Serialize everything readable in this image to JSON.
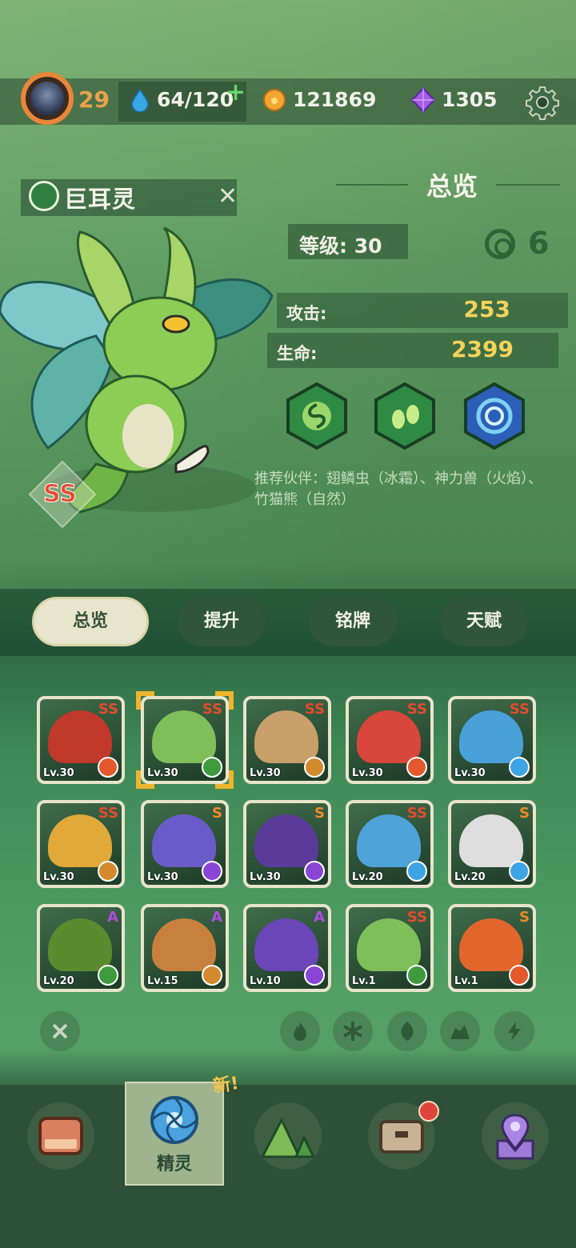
{
  "player": {
    "level": "29"
  },
  "resources": {
    "stamina": "64/120",
    "coins": "121869",
    "gems": "1305"
  },
  "monster": {
    "name": "巨耳灵",
    "grade": "SS"
  },
  "overview": {
    "title": "总览",
    "level_label": "等级: 30",
    "attack_label": "攻击:",
    "attack_value": "253",
    "hp_label": "生命:",
    "hp_value": "2399",
    "recommend_text": "推荐伙伴：翅鳞虫（冰霜）、神力兽（火焰）、竹猫熊（自然）"
  },
  "tabs": [
    {
      "label": "总览"
    },
    {
      "label": "提升"
    },
    {
      "label": "铭牌"
    },
    {
      "label": "天赋"
    }
  ],
  "cards": [
    {
      "level": "Lv.30",
      "grade": "SS",
      "element": "fire",
      "color": "#c0392b"
    },
    {
      "level": "Lv.30",
      "grade": "SS",
      "element": "nature",
      "color": "#7fbf5a"
    },
    {
      "level": "Lv.30",
      "grade": "SS",
      "element": "earth",
      "color": "#c9a06a"
    },
    {
      "level": "Lv.30",
      "grade": "SS",
      "element": "fire",
      "color": "#d9463b"
    },
    {
      "level": "Lv.30",
      "grade": "SS",
      "element": "ice",
      "color": "#4aa0d8"
    },
    {
      "level": "Lv.30",
      "grade": "SS",
      "element": "earth",
      "color": "#e0a93a"
    },
    {
      "level": "Lv.30",
      "grade": "S",
      "element": "thunder",
      "color": "#6a5bc9"
    },
    {
      "level": "Lv.30",
      "grade": "S",
      "element": "thunder",
      "color": "#5b3b9a"
    },
    {
      "level": "Lv.20",
      "grade": "SS",
      "element": "ice",
      "color": "#4fa3db"
    },
    {
      "level": "Lv.20",
      "grade": "S",
      "element": "ice",
      "color": "#dedede"
    },
    {
      "level": "Lv.20",
      "grade": "A",
      "element": "nature",
      "color": "#5c8a2f"
    },
    {
      "level": "Lv.15",
      "grade": "A",
      "element": "earth",
      "color": "#c8813d"
    },
    {
      "level": "Lv.10",
      "grade": "A",
      "element": "thunder",
      "color": "#6b46b8"
    },
    {
      "level": "Lv.1",
      "grade": "SS",
      "element": "nature",
      "color": "#7fbf5a"
    },
    {
      "level": "Lv.1",
      "grade": "S",
      "element": "fire",
      "color": "#e2662c"
    }
  ],
  "nav": {
    "spirit_label": "精灵",
    "new_badge": "新!"
  },
  "colors": {
    "accent_gold": "#f4d35a",
    "grade_ss": "#e54b2e",
    "grade_s": "#f08a2a",
    "grade_a": "#b04be0"
  }
}
